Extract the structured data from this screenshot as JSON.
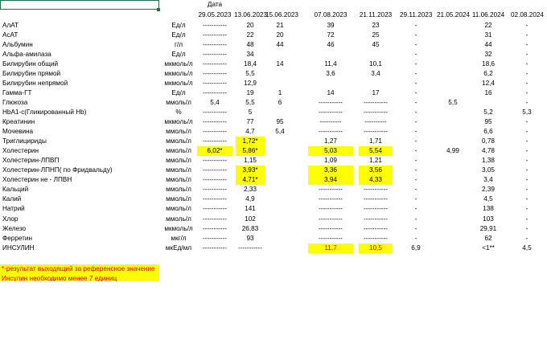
{
  "header": {
    "top_label": "Дата",
    "dates": [
      "29.05.2023",
      "13.06.2023",
      "15.06.2023",
      "07.08.2023",
      "21.11.2023",
      "29.11.2023",
      "21.05.2024",
      "11.06.2024",
      "02.08.2024"
    ]
  },
  "rows": [
    {
      "name": "АлАТ",
      "unit": "Ед/л",
      "values": [
        "-----------",
        "20",
        "21",
        "39",
        "23",
        "-",
        "",
        "22",
        "-"
      ]
    },
    {
      "name": "АсАТ",
      "unit": "Ед/л",
      "values": [
        "-----------",
        "22",
        "20",
        "72",
        "25",
        "-",
        "",
        "31",
        "-"
      ]
    },
    {
      "name": "Альбумин",
      "unit": "г/л",
      "values": [
        "-----------",
        "48",
        "44",
        "46",
        "45",
        "-",
        "",
        "44",
        "-"
      ]
    },
    {
      "name": "Альфа-амилаза",
      "unit": "Ед/л",
      "values": [
        "-----------",
        "34",
        "",
        "",
        "",
        "-",
        "",
        "32",
        "-"
      ]
    },
    {
      "name": "Билирубин общий",
      "unit": "мкмоль/л",
      "values": [
        "-----------",
        "18,4",
        "14",
        "11,4",
        "10,1",
        "-",
        "",
        "18,6",
        "-"
      ]
    },
    {
      "name": "Билирубин прямой",
      "unit": "мкмоль/л",
      "values": [
        "-----------",
        "5,5",
        "",
        "3,6",
        "3,4",
        "-",
        "",
        "6,2",
        "-"
      ]
    },
    {
      "name": "Билирубин непрямой",
      "unit": "мкмоль/л",
      "values": [
        "-----------",
        "12,9",
        "",
        "",
        "",
        "-",
        "",
        "12,4",
        "-"
      ]
    },
    {
      "name": "Гамма-ГТ",
      "unit": "Ед/л",
      "values": [
        "-----------",
        "19",
        "1",
        "14",
        "17",
        "-",
        "",
        "16",
        "-"
      ]
    },
    {
      "name": "Глюкоза",
      "unit": "ммоль/л",
      "values": [
        "5,4",
        "5,5",
        "6",
        "-----------",
        "-----------",
        "-",
        "5,5",
        "",
        "-"
      ]
    },
    {
      "name": "HbA1-c(Гликированный Hb)",
      "unit": "%",
      "values": [
        "-----------",
        "5",
        "",
        "-----------",
        "-----------",
        "-",
        "",
        "5,2",
        "5,3"
      ]
    },
    {
      "name": "Креатинин",
      "unit": "мкмоль/л",
      "values": [
        "-----------",
        "77",
        "95",
        "----------",
        "----------",
        "-",
        "",
        "95",
        "-"
      ]
    },
    {
      "name": "Мочевина",
      "unit": "ммоль/л",
      "values": [
        "-----------",
        "4,7",
        "5,4",
        "-----------",
        "-----------",
        "-",
        "",
        "6,6",
        "-"
      ]
    },
    {
      "name": "Триглицириды",
      "unit": "ммоль/л",
      "values": [
        "-----------",
        "1,72*",
        "",
        "1,27",
        "1,71",
        "-",
        "",
        "0,78",
        "-"
      ]
    },
    {
      "name": "Холестерин",
      "unit": "ммоль/л",
      "values": [
        "6,02*",
        "5,86*",
        "",
        "5,03",
        "5,54",
        "-",
        "4,99",
        "4,78",
        "-"
      ]
    },
    {
      "name": "Холестерин-ЛПВП",
      "unit": "ммоль/л",
      "values": [
        "-----------",
        "1,15",
        "",
        "1,09",
        "1,21",
        "-",
        "",
        "1,38",
        "-"
      ]
    },
    {
      "name": "Холестерин-ЛПНП( по Фридвальду)",
      "unit": "ммоль/л",
      "values": [
        "-----------",
        "3,93*",
        "",
        "3,36",
        "3,56",
        "-",
        "",
        "3,05",
        "-"
      ]
    },
    {
      "name": "Холестерин не - ЛПВН",
      "unit": "ммоль/л",
      "values": [
        "-----------",
        "4,71*",
        "",
        "3,94",
        "4,33",
        "-",
        "",
        "3,4",
        "-"
      ]
    },
    {
      "name": "Кальций",
      "unit": "ммоль/л",
      "values": [
        "-----------",
        "2,33",
        "",
        "-----------",
        "-----------",
        "-",
        "",
        "2,39",
        "-"
      ]
    },
    {
      "name": "Калий",
      "unit": "ммоль/л",
      "values": [
        "-----------",
        "4,9",
        "",
        "-----------",
        "-----------",
        "-",
        "",
        "4,5",
        "-"
      ]
    },
    {
      "name": "Натрий",
      "unit": "ммоль/л",
      "values": [
        "-----------",
        "141",
        "",
        "-----------",
        "-----------",
        "-",
        "",
        "138",
        "-"
      ]
    },
    {
      "name": "Хлор",
      "unit": "ммоль/л",
      "values": [
        "-----------",
        "102",
        "",
        "-----------",
        "-----------",
        "-",
        "",
        "103",
        "-"
      ]
    },
    {
      "name": "Железо",
      "unit": "мкмоль/л",
      "values": [
        "-----------",
        "26,83",
        "",
        "-----------",
        "-----------",
        "-",
        "",
        "29,91",
        "-"
      ]
    },
    {
      "name": "Ферретин",
      "unit": "мкг/л",
      "values": [
        "-----------",
        "93",
        "",
        "-----------",
        "-----------",
        "-",
        "",
        "62",
        "-"
      ]
    },
    {
      "name": "ИНСУЛИН",
      "unit": "мкЕд/мл",
      "values": [
        "-----------",
        "-----------",
        "",
        "11,7",
        "10,5",
        "6,9",
        "",
        "<1**",
        "4,5"
      ]
    }
  ],
  "highlights": [
    [
      12,
      1
    ],
    [
      13,
      0
    ],
    [
      13,
      1
    ],
    [
      13,
      3
    ],
    [
      13,
      4
    ],
    [
      15,
      1
    ],
    [
      15,
      3
    ],
    [
      15,
      4
    ],
    [
      16,
      1
    ],
    [
      16,
      3
    ],
    [
      16,
      4
    ],
    [
      23,
      3
    ],
    [
      23,
      4
    ]
  ],
  "red_cells": [
    [
      23,
      3
    ],
    [
      23,
      4
    ]
  ],
  "notes": [
    "*-результат выходящий за референсное значение",
    "Инсулин необходимо менее 7 единиц"
  ],
  "colors": {
    "highlight": "#ffff00",
    "note_text": "#e00000",
    "selection": "#1e7145"
  }
}
